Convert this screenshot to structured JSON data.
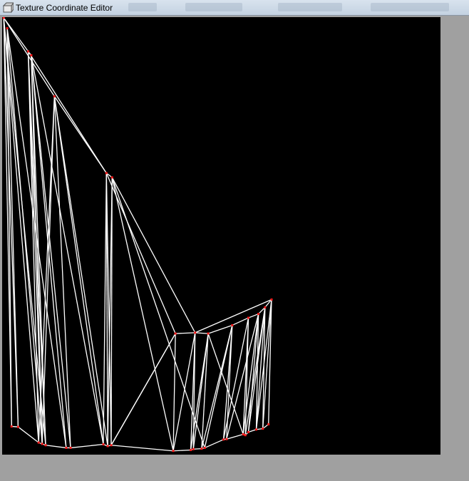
{
  "window": {
    "title": "Texture Coordinate Editor",
    "icon": "app-icon"
  },
  "colors": {
    "canvas": "#000000",
    "edge": "#ffffff",
    "vertex": "#ff1a1a",
    "frame": "#a0a0a0"
  },
  "uv_mesh": {
    "vertices": [
      [
        0.002,
        0.0
      ],
      [
        0.01,
        0.024
      ],
      [
        0.058,
        0.077
      ],
      [
        0.065,
        0.086
      ],
      [
        0.118,
        0.18
      ],
      [
        0.237,
        0.356
      ],
      [
        0.25,
        0.366
      ],
      [
        0.395,
        0.724
      ],
      [
        0.44,
        0.722
      ],
      [
        0.47,
        0.724
      ],
      [
        0.525,
        0.705
      ],
      [
        0.562,
        0.688
      ],
      [
        0.585,
        0.679
      ],
      [
        0.6,
        0.664
      ],
      [
        0.615,
        0.646
      ],
      [
        0.02,
        0.937
      ],
      [
        0.035,
        0.938
      ],
      [
        0.082,
        0.974
      ],
      [
        0.09,
        0.977
      ],
      [
        0.098,
        0.98
      ],
      [
        0.145,
        0.986
      ],
      [
        0.155,
        0.986
      ],
      [
        0.23,
        0.978
      ],
      [
        0.24,
        0.982
      ],
      [
        0.248,
        0.98
      ],
      [
        0.39,
        0.993
      ],
      [
        0.43,
        0.991
      ],
      [
        0.436,
        0.989
      ],
      [
        0.455,
        0.988
      ],
      [
        0.462,
        0.986
      ],
      [
        0.505,
        0.967
      ],
      [
        0.512,
        0.966
      ],
      [
        0.55,
        0.955
      ],
      [
        0.555,
        0.957
      ],
      [
        0.562,
        0.95
      ],
      [
        0.58,
        0.944
      ],
      [
        0.595,
        0.942
      ],
      [
        0.608,
        0.932
      ]
    ],
    "edges": [
      [
        0,
        2
      ],
      [
        2,
        3
      ],
      [
        0,
        4
      ],
      [
        4,
        5
      ],
      [
        5,
        6
      ],
      [
        2,
        5
      ],
      [
        6,
        8
      ],
      [
        5,
        7
      ],
      [
        7,
        8
      ],
      [
        8,
        9
      ],
      [
        9,
        10
      ],
      [
        10,
        11
      ],
      [
        11,
        12
      ],
      [
        12,
        13
      ],
      [
        13,
        14
      ],
      [
        8,
        14
      ],
      [
        15,
        16
      ],
      [
        16,
        17
      ],
      [
        17,
        18
      ],
      [
        18,
        19
      ],
      [
        19,
        20
      ],
      [
        20,
        21
      ],
      [
        21,
        22
      ],
      [
        22,
        23
      ],
      [
        23,
        24
      ],
      [
        24,
        25
      ],
      [
        25,
        26
      ],
      [
        26,
        27
      ],
      [
        27,
        28
      ],
      [
        28,
        29
      ],
      [
        29,
        30
      ],
      [
        30,
        31
      ],
      [
        31,
        32
      ],
      [
        32,
        33
      ],
      [
        33,
        34
      ],
      [
        34,
        35
      ],
      [
        35,
        36
      ],
      [
        36,
        37
      ],
      [
        0,
        15
      ],
      [
        1,
        15
      ],
      [
        0,
        16
      ],
      [
        1,
        16
      ],
      [
        0,
        17
      ],
      [
        1,
        18
      ],
      [
        0,
        19
      ],
      [
        1,
        20
      ],
      [
        2,
        17
      ],
      [
        2,
        18
      ],
      [
        3,
        18
      ],
      [
        3,
        19
      ],
      [
        2,
        19
      ],
      [
        3,
        20
      ],
      [
        3,
        21
      ],
      [
        3,
        22
      ],
      [
        4,
        17
      ],
      [
        4,
        18
      ],
      [
        4,
        21
      ],
      [
        4,
        22
      ],
      [
        4,
        23
      ],
      [
        5,
        22
      ],
      [
        5,
        23
      ],
      [
        6,
        23
      ],
      [
        6,
        24
      ],
      [
        6,
        25
      ],
      [
        5,
        24
      ],
      [
        7,
        24
      ],
      [
        7,
        25
      ],
      [
        8,
        25
      ],
      [
        8,
        26
      ],
      [
        9,
        26
      ],
      [
        9,
        27
      ],
      [
        9,
        28
      ],
      [
        9,
        32
      ],
      [
        8,
        27
      ],
      [
        10,
        28
      ],
      [
        10,
        29
      ],
      [
        10,
        30
      ],
      [
        10,
        31
      ],
      [
        11,
        30
      ],
      [
        11,
        32
      ],
      [
        11,
        33
      ],
      [
        12,
        31
      ],
      [
        12,
        32
      ],
      [
        12,
        34
      ],
      [
        12,
        35
      ],
      [
        13,
        33
      ],
      [
        13,
        34
      ],
      [
        13,
        35
      ],
      [
        13,
        36
      ],
      [
        14,
        35
      ],
      [
        14,
        36
      ],
      [
        14,
        37
      ],
      [
        6,
        29
      ],
      [
        24,
        7
      ]
    ]
  }
}
